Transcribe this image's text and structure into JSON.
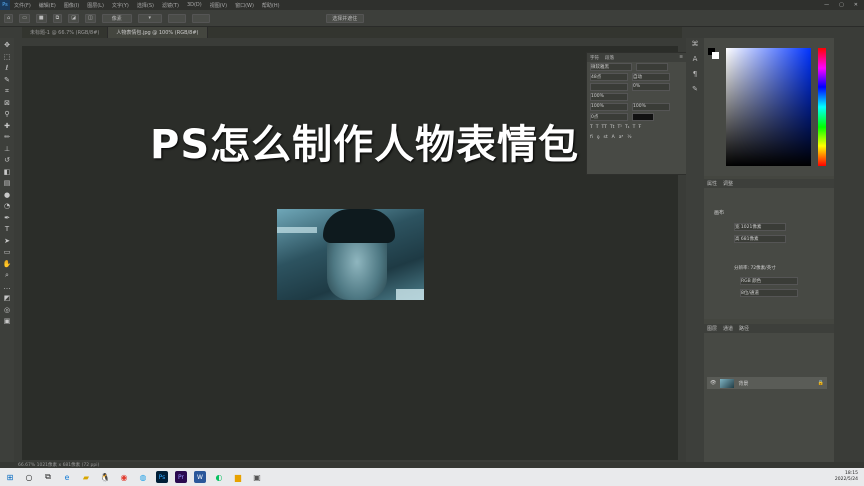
{
  "app": {
    "logo": "Ps"
  },
  "menu": [
    "文件(F)",
    "编辑(E)",
    "图像(I)",
    "图层(L)",
    "文字(Y)",
    "选择(S)",
    "滤镜(T)",
    "3D(D)",
    "视图(V)",
    "窗口(W)",
    "帮助(H)"
  ],
  "window_controls": [
    "—",
    "▢",
    "✕"
  ],
  "options_bar": {
    "tool_label": "像素",
    "align_label": "选择并遮住"
  },
  "tabs": [
    "未标题-1 @ 66.7% (RGB/8#)",
    "人物表情包.jpg @ 100% (RGB/8#)"
  ],
  "overlay_title": "PS怎么制作人物表情包",
  "character_panel": {
    "tabs": [
      "字符",
      "段落"
    ],
    "rows": [
      "微软雅黑",
      "48点",
      "自动",
      "0%",
      "100%",
      "0点"
    ]
  },
  "properties_panel": {
    "tabs": [
      "属性",
      "调整"
    ],
    "section": "画布",
    "fields": [
      "宽 1021像素",
      "高 681像素",
      "分辨率: 72像素/英寸",
      "RGB 颜色",
      "8位/通道"
    ]
  },
  "layers_panel": {
    "tabs": [
      "图层",
      "通道",
      "路径"
    ],
    "layer_name": "背景"
  },
  "status_text": "66.67%   1021像素 x 681像素 (72 ppi)",
  "taskbar": {
    "icons": [
      "windows-icon",
      "search-icon",
      "taskview-icon",
      "edge-icon",
      "explorer-icon",
      "qq-icon",
      "browser-icon",
      "media-icon",
      "photoshop-icon",
      "premiere-icon",
      "word-icon",
      "chat-icon",
      "folder-icon",
      "app-icon"
    ],
    "time": "18:15",
    "date": "2022/5/24"
  },
  "colors": {
    "canvas": "#2b2d29",
    "ui": "#3d3f3b",
    "accent": "#1b3a5c"
  }
}
